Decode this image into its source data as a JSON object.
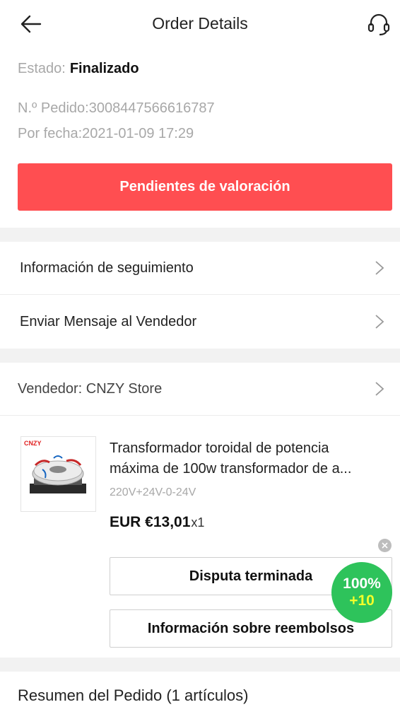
{
  "header": {
    "title": "Order Details",
    "back_icon": "arrow-left-icon",
    "support_icon": "headset-icon"
  },
  "order": {
    "status_label": "Estado:",
    "status_value": "Finalizado",
    "order_number": "N.º Pedido:3008447566616787",
    "order_date": "Por fecha:2021-01-09 17:29",
    "primary_action": "Pendientes de valoración"
  },
  "links": {
    "tracking": "Información de seguimiento",
    "message_seller": "Enviar Mensaje al Vendedor"
  },
  "seller": {
    "label": "Vendedor: CNZY Store"
  },
  "product": {
    "brand_logo_text": "CNZY",
    "title_line1": "Transformador toroidal de potencia",
    "title_line2": "máxima de 100w transformador de a...",
    "variant": "220V+24V-0-24V",
    "price": "EUR €13,01",
    "quantity": "x1"
  },
  "actions": {
    "dispute": "Disputa terminada",
    "refund_info": "Información sobre reembolsos"
  },
  "badge": {
    "percent": "100%",
    "points": "+10"
  },
  "summary": {
    "title": "Resumen del Pedido (1 artículos)"
  },
  "colors": {
    "primary": "#ff4e51",
    "badge_green": "#2ec35b",
    "badge_yellow": "#f3ff2a"
  }
}
